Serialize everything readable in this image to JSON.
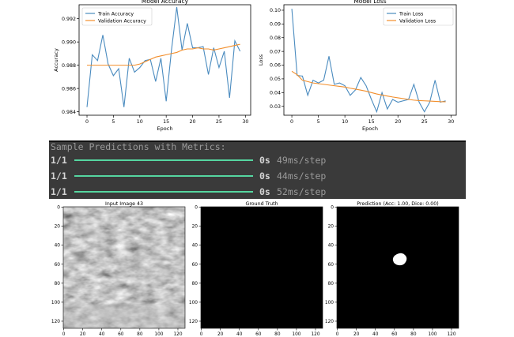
{
  "charts": [
    {
      "type": "line",
      "title": "Model Accuracy",
      "xlabel": "Epoch",
      "ylabel": "Accuracy",
      "xlim": [
        -1.5,
        31
      ],
      "ylim": [
        0.9837,
        0.9932
      ],
      "xticks": [
        0,
        5,
        10,
        15,
        20,
        25,
        30
      ],
      "yticks": [
        0.984,
        0.986,
        0.988,
        0.99,
        0.992
      ],
      "ytick_labels": [
        "0.984",
        "0.986",
        "0.988",
        "0.990",
        "0.992"
      ],
      "legend_position": "top-left",
      "grid": false,
      "series": [
        {
          "name": "Train Accuracy",
          "color": "#4a8bbf",
          "x": [
            0,
            1,
            2,
            3,
            4,
            5,
            6,
            7,
            8,
            9,
            10,
            11,
            12,
            13,
            14,
            15,
            16,
            17,
            18,
            19,
            20,
            21,
            22,
            23,
            24,
            25,
            26,
            27,
            28,
            29
          ],
          "values": [
            0.9844,
            0.9889,
            0.9884,
            0.9906,
            0.9881,
            0.9871,
            0.9877,
            0.9844,
            0.9886,
            0.9874,
            0.9878,
            0.9884,
            0.9885,
            0.9866,
            0.9886,
            0.9849,
            0.9893,
            0.993,
            0.9893,
            0.9916,
            0.9895,
            0.9895,
            0.9896,
            0.9872,
            0.9895,
            0.9878,
            0.9892,
            0.9852,
            0.9901,
            0.9892
          ]
        },
        {
          "name": "Validation Accuracy",
          "color": "#f28e2b",
          "x": [
            0,
            1,
            2,
            3,
            4,
            5,
            6,
            7,
            8,
            9,
            10,
            11,
            12,
            13,
            14,
            15,
            16,
            17,
            18,
            19,
            20,
            21,
            22,
            23,
            24,
            25,
            26,
            27,
            28,
            29
          ],
          "values": [
            0.988,
            0.988,
            0.988,
            0.988,
            0.988,
            0.988,
            0.988,
            0.988,
            0.988,
            0.988,
            0.9881,
            0.9883,
            0.9885,
            0.9887,
            0.9888,
            0.9889,
            0.989,
            0.9891,
            0.9893,
            0.9894,
            0.9894,
            0.9895,
            0.9894,
            0.9894,
            0.9893,
            0.9894,
            0.9895,
            0.9896,
            0.9897,
            0.9898
          ]
        }
      ]
    },
    {
      "type": "line",
      "title": "Model Loss",
      "xlabel": "Epoch",
      "ylabel": "Loss",
      "xlim": [
        -1.5,
        31
      ],
      "ylim": [
        0.0235,
        0.104
      ],
      "xticks": [
        0,
        5,
        10,
        15,
        20,
        25,
        30
      ],
      "yticks": [
        0.03,
        0.04,
        0.05,
        0.06,
        0.07,
        0.08,
        0.09,
        0.1
      ],
      "ytick_labels": [
        "0.03",
        "0.04",
        "0.05",
        "0.06",
        "0.07",
        "0.08",
        "0.09",
        "0.10"
      ],
      "legend_position": "top-right",
      "grid": false,
      "series": [
        {
          "name": "Train Loss",
          "color": "#4a8bbf",
          "x": [
            0,
            1,
            2,
            3,
            4,
            5,
            6,
            7,
            8,
            9,
            10,
            11,
            12,
            13,
            14,
            15,
            16,
            17,
            18,
            19,
            20,
            21,
            22,
            23,
            24,
            25,
            26,
            27,
            28,
            29
          ],
          "values": [
            0.101,
            0.0525,
            0.052,
            0.038,
            0.049,
            0.047,
            0.049,
            0.0665,
            0.046,
            0.047,
            0.045,
            0.038,
            0.042,
            0.051,
            0.045,
            0.035,
            0.026,
            0.04,
            0.028,
            0.035,
            0.033,
            0.034,
            0.035,
            0.046,
            0.033,
            0.026,
            0.033,
            0.049,
            0.033,
            0.034
          ]
        },
        {
          "name": "Validation Loss",
          "color": "#f28e2b",
          "x": [
            0,
            1,
            2,
            3,
            4,
            5,
            6,
            7,
            8,
            9,
            10,
            11,
            12,
            13,
            14,
            15,
            16,
            17,
            18,
            19,
            20,
            21,
            22,
            23,
            24,
            25,
            26,
            27,
            28,
            29
          ],
          "values": [
            0.0555,
            0.053,
            0.049,
            0.048,
            0.047,
            0.0465,
            0.046,
            0.0455,
            0.045,
            0.0445,
            0.044,
            0.0432,
            0.0425,
            0.0418,
            0.041,
            0.04,
            0.039,
            0.0382,
            0.0375,
            0.0368,
            0.0362,
            0.0356,
            0.035,
            0.0345,
            0.0342,
            0.034,
            0.0338,
            0.0336,
            0.0334,
            0.0333
          ]
        }
      ]
    }
  ],
  "console": {
    "header": "Sample Predictions with Metrics:",
    "rows": [
      {
        "step": "1/1",
        "time": "0s",
        "per_step": "49ms/step"
      },
      {
        "step": "1/1",
        "time": "0s",
        "per_step": "44ms/step"
      },
      {
        "step": "1/1",
        "time": "0s",
        "per_step": "52ms/step"
      }
    ],
    "progress": 1.0,
    "colors": {
      "background": "#3a3a3a",
      "text": "#d4d4d4",
      "muted": "#9a9a9a",
      "bar": "#55d6a0"
    }
  },
  "images": [
    {
      "title": "Input Image 43",
      "content": "grayscale-ultrasound",
      "xticks": [
        "0",
        "20",
        "40",
        "60",
        "80",
        "100",
        "120"
      ],
      "yticks": [
        "0",
        "20",
        "40",
        "60",
        "80",
        "100",
        "120"
      ]
    },
    {
      "title": "Ground Truth",
      "content": "empty-mask",
      "xticks": [
        "0",
        "20",
        "40",
        "60",
        "80",
        "100",
        "120"
      ],
      "yticks": [
        "0",
        "20",
        "40",
        "60",
        "80",
        "100",
        "120"
      ]
    },
    {
      "title": "Prediction (Acc: 1.00, Dice: 0.00)",
      "content": "mask-with-blob",
      "xticks": [
        "0",
        "20",
        "40",
        "60",
        "80",
        "100",
        "120"
      ],
      "yticks": [
        "0",
        "20",
        "40",
        "60",
        "80",
        "100",
        "120"
      ]
    }
  ]
}
